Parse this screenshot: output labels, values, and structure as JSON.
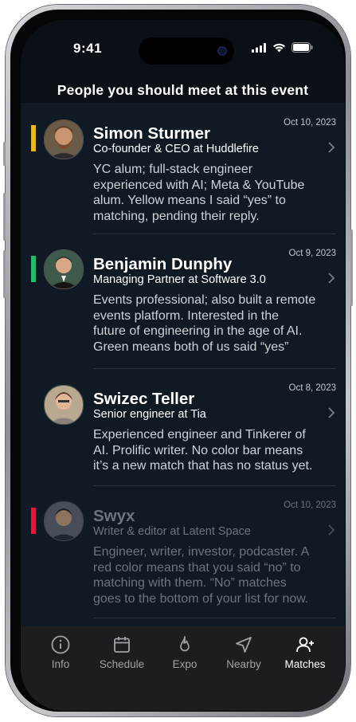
{
  "status": {
    "time": "9:41"
  },
  "header": {
    "title": "People you should meet at this event"
  },
  "matches": [
    {
      "name": "Simon Sturmer",
      "role": "Co-founder & CEO at Huddlefire",
      "date": "Oct 10, 2023",
      "description": [
        "YC alum; full-stack engineer",
        "experienced with AI; Meta & YouTube",
        "alum. Yellow means I said “yes” to",
        "matching, pending their reply."
      ],
      "status_color": "#f2b705",
      "status": "pending"
    },
    {
      "name": "Benjamin Dunphy",
      "role": "Managing Partner at Software 3.0",
      "date": "Oct 9, 2023",
      "description": [
        "Events professional; also built a remote",
        "events platform. Interested in the",
        "future of engineering in the age of AI.",
        "Green means both of us said “yes”"
      ],
      "status_color": "#18c26a",
      "status": "matched"
    },
    {
      "name": "Swizec Teller",
      "role": "Senior engineer at Tia",
      "date": "Oct 8, 2023",
      "description": [
        "Experienced engineer and Tinkerer of",
        "AI. Prolific writer. No color bar means",
        "it’s a new match that has no status yet."
      ],
      "status_color": null,
      "status": "new"
    },
    {
      "name": "Swyx",
      "role": "Writer & editor at Latent Space",
      "date": "Oct 10, 2023",
      "description": [
        "Engineer, writer, investor, podcaster. A",
        "red color means that you said “no” to",
        "matching with them. “No” matches",
        "goes to the bottom of your list for now."
      ],
      "status_color": "#e8163c",
      "status": "declined"
    }
  ],
  "tabs": [
    {
      "label": "Info",
      "icon": "info-icon",
      "active": false
    },
    {
      "label": "Schedule",
      "icon": "calendar-icon",
      "active": false
    },
    {
      "label": "Expo",
      "icon": "flame-icon",
      "active": false
    },
    {
      "label": "Nearby",
      "icon": "navigation-icon",
      "active": false
    },
    {
      "label": "Matches",
      "icon": "add-person-icon",
      "active": true
    }
  ]
}
